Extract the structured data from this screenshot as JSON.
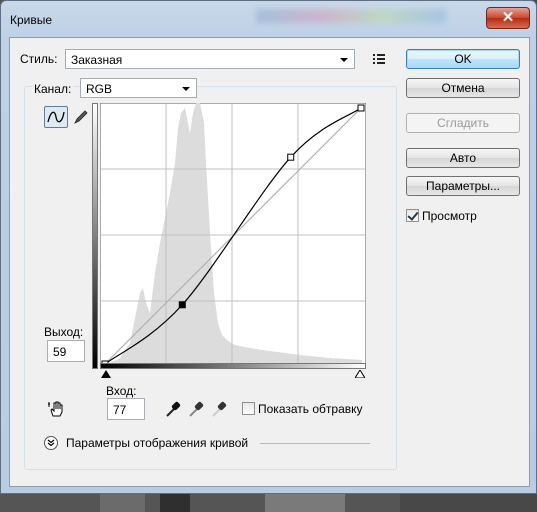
{
  "window": {
    "title": "Кривые",
    "close_glyph": "✕"
  },
  "style": {
    "label": "Стиль:",
    "value": "Заказная"
  },
  "buttons": {
    "ok": "OK",
    "cancel": "Отмена",
    "smooth": "Сгладить",
    "auto": "Авто",
    "options": "Параметры..."
  },
  "preview": {
    "label": "Просмотр",
    "checked": true
  },
  "channel": {
    "label": "Канал:",
    "value": "RGB"
  },
  "output": {
    "label": "Выход:",
    "value": "59"
  },
  "input": {
    "label": "Вход:",
    "value": "77"
  },
  "clipping": {
    "label": "Показать обтравку",
    "checked": false
  },
  "curve_display": {
    "label": "Параметры отображения кривой"
  },
  "icons": {
    "presets_menu": "list-icon",
    "curve_tool": "curve-icon",
    "pencil_tool": "pencil-icon",
    "hand_tool": "hand-icon",
    "black_eyedropper": "eyedropper-icon",
    "gray_eyedropper": "eyedropper-icon",
    "white_eyedropper": "eyedropper-icon",
    "expand": "chevron-down-icon"
  },
  "curve": {
    "points": [
      [
        0,
        0
      ],
      [
        77,
        59
      ],
      [
        185,
        206
      ],
      [
        255,
        255
      ]
    ]
  }
}
